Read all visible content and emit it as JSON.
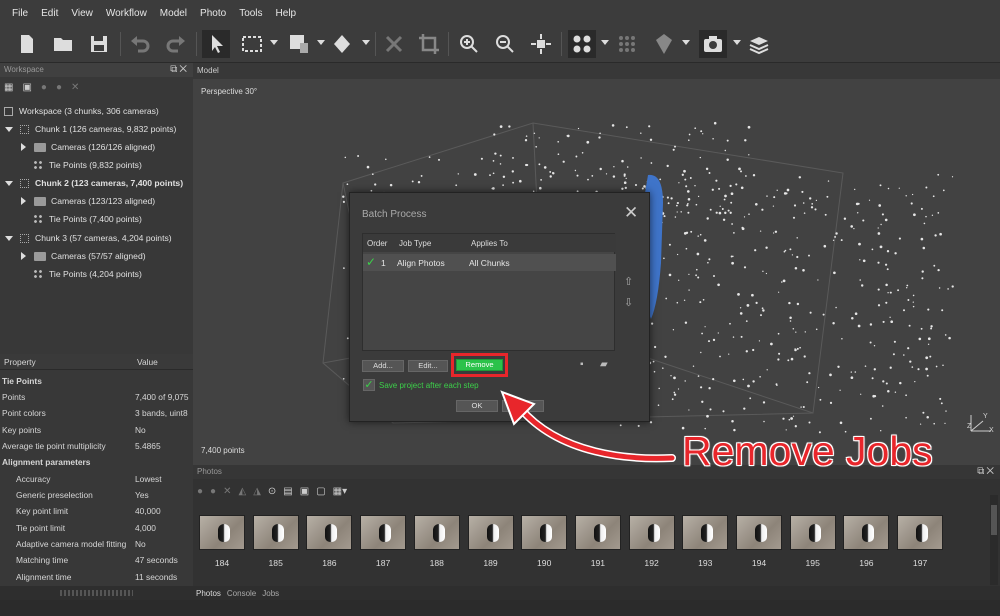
{
  "menu": [
    "File",
    "Edit",
    "View",
    "Workflow",
    "Model",
    "Photo",
    "Tools",
    "Help"
  ],
  "workspace": {
    "title": "Workspace",
    "tree": [
      {
        "label": "Workspace (3 chunks, 306 cameras)",
        "bold": false
      },
      {
        "label": "Chunk 1 (126 cameras, 9,832 points)",
        "bold": false
      },
      {
        "label": "Cameras (126/126 aligned)",
        "bold": false
      },
      {
        "label": "Tie Points (9,832 points)",
        "bold": false
      },
      {
        "label": "Chunk 2 (123 cameras, 7,400 points)",
        "bold": true
      },
      {
        "label": "Cameras (123/123 aligned)",
        "bold": false
      },
      {
        "label": "Tie Points (7,400 points)",
        "bold": false
      },
      {
        "label": "Chunk 3 (57 cameras, 4,204 points)",
        "bold": false
      },
      {
        "label": "Cameras (57/57 aligned)",
        "bold": false
      },
      {
        "label": "Tie Points (4,204 points)",
        "bold": false
      }
    ]
  },
  "properties": {
    "col_property": "Property",
    "col_value": "Value",
    "rows": [
      {
        "k": "Tie Points",
        "v": "",
        "section": true,
        "indent": false
      },
      {
        "k": "Points",
        "v": "7,400 of 9,075",
        "section": false,
        "indent": false
      },
      {
        "k": "Point colors",
        "v": "3 bands, uint8",
        "section": false,
        "indent": false
      },
      {
        "k": "Key points",
        "v": "No",
        "section": false,
        "indent": false
      },
      {
        "k": "Average tie point multiplicity",
        "v": "5.4865",
        "section": false,
        "indent": false
      },
      {
        "k": "Alignment parameters",
        "v": "",
        "section": true,
        "indent": false
      },
      {
        "k": "Accuracy",
        "v": "Lowest",
        "section": false,
        "indent": true
      },
      {
        "k": "Generic preselection",
        "v": "Yes",
        "section": false,
        "indent": true
      },
      {
        "k": "Key point limit",
        "v": "40,000",
        "section": false,
        "indent": true
      },
      {
        "k": "Tie point limit",
        "v": "4,000",
        "section": false,
        "indent": true
      },
      {
        "k": "Adaptive camera model fitting",
        "v": "No",
        "section": false,
        "indent": true
      },
      {
        "k": "Matching time",
        "v": "47 seconds",
        "section": false,
        "indent": true
      },
      {
        "k": "Alignment time",
        "v": "11 seconds",
        "section": false,
        "indent": true
      }
    ]
  },
  "model": {
    "tab": "Model",
    "perspective": "Perspective 30°",
    "points": "7,400 points",
    "axes": [
      "X",
      "Y",
      "Z"
    ]
  },
  "dialog": {
    "title": "Batch Process",
    "columns": [
      "Order",
      "Job Type",
      "Applies To"
    ],
    "jobs": [
      {
        "order": "1",
        "type": "Align Photos",
        "applies": "All Chunks"
      }
    ],
    "add": "Add...",
    "edit": "Edit...",
    "remove": "Remove",
    "save_label": "Save project after each step",
    "ok": "OK"
  },
  "photos": {
    "title": "Photos",
    "labels": [
      "184",
      "185",
      "186",
      "187",
      "188",
      "189",
      "190",
      "191",
      "192",
      "193",
      "194",
      "195",
      "196",
      "197"
    ]
  },
  "bottom_tabs": [
    "Photos",
    "Console",
    "Jobs"
  ],
  "annotation": {
    "text": "Remove Jobs",
    "color": "#e8262b"
  },
  "colors": {
    "remove_button": "#2bc24a",
    "highlight": "#e8262b",
    "check": "#3cd04a"
  }
}
